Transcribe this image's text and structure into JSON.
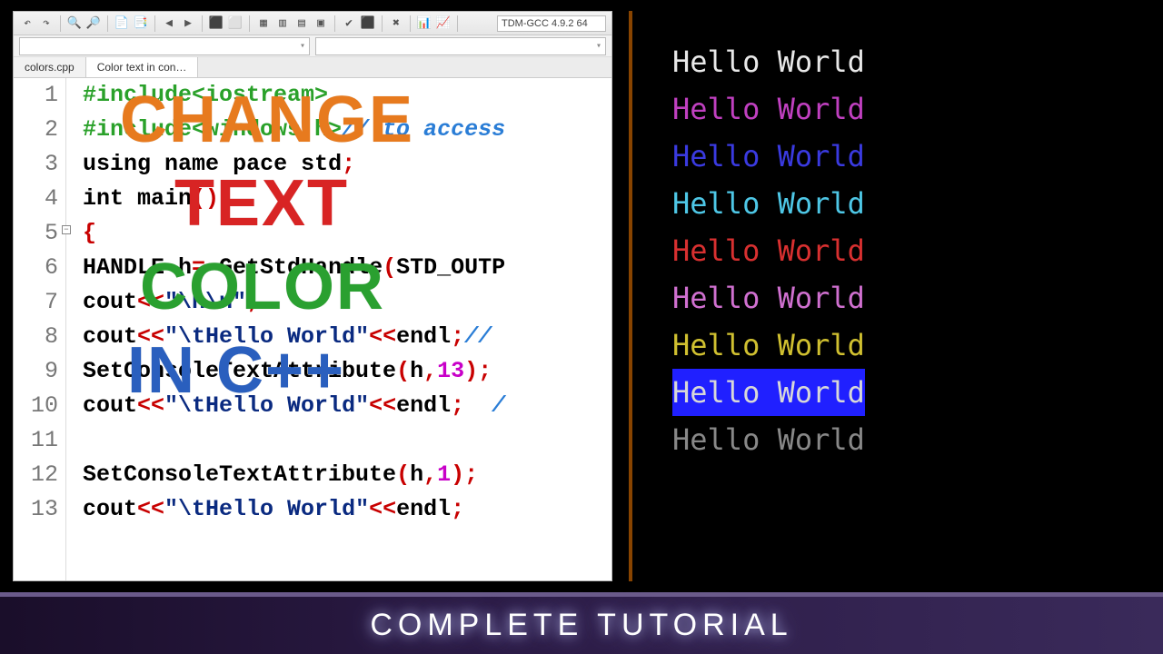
{
  "toolbar": {
    "icons": [
      "↶",
      "↷",
      "|",
      "🔍",
      "🔎",
      "|",
      "📄",
      "📑",
      "|",
      "◀",
      "▶",
      "|",
      "⬛",
      "⬜",
      "|",
      "▦",
      "▥",
      "▤",
      "▣",
      "|",
      "✔",
      "⬛",
      "|",
      "✖",
      "|",
      "📊",
      "📈",
      "|"
    ],
    "compiler": "TDM-GCC 4.9.2 64"
  },
  "tabs": [
    {
      "label": "colors.cpp",
      "active": false
    },
    {
      "label": "Color text in con…",
      "active": true
    }
  ],
  "code": {
    "lines": [
      {
        "n": "1",
        "html": "<span class='pp'>#include&lt;iostream&gt;</span>"
      },
      {
        "n": "2",
        "html": "<span class='pp'>#include&lt;windows.h&gt;</span><span class='cmt'>// to access</span>"
      },
      {
        "n": "3",
        "html": "<span class='kw'>using</span> <span class='kw'>name</span> <span class='kw'>pace</span> <span class='kw'>std</span><span class='sym'>;</span>"
      },
      {
        "n": "4",
        "html": "<span class='kw'>int</span> main<span class='sym'>()</span>"
      },
      {
        "n": "5",
        "html": "<span class='sym'>{</span>",
        "fold": true
      },
      {
        "n": "6",
        "html": "HANDLE h<span class='sym'>=</span> GetStdHandle<span class='sym'>(</span>STD_OUTP"
      },
      {
        "n": "7",
        "html": "cout<span class='sym'>&lt;&lt;</span><span class='str'>\"\\n\\n\"</span><span class='sym'>;</span>"
      },
      {
        "n": "8",
        "html": "cout<span class='sym'>&lt;&lt;</span><span class='str'>\"\\tHello World\"</span><span class='sym'>&lt;&lt;</span>endl<span class='sym'>;</span><span class='cmt'>//</span>"
      },
      {
        "n": "9",
        "html": "SetConsoleTextAttribute<span class='sym'>(</span>h<span class='sym'>,</span><span class='num'>13</span><span class='sym'>);</span>"
      },
      {
        "n": "10",
        "html": "cout<span class='sym'>&lt;&lt;</span><span class='str'>\"\\tHello World\"</span><span class='sym'>&lt;&lt;</span>endl<span class='sym'>;</span>  <span class='cmt'>/</span>"
      },
      {
        "n": "11",
        "html": ""
      },
      {
        "n": "12",
        "html": "SetConsoleTextAttribute<span class='sym'>(</span>h<span class='sym'>,</span><span class='num'>1</span><span class='sym'>);</span>"
      },
      {
        "n": "13",
        "html": "cout<span class='sym'>&lt;&lt;</span><span class='str'>\"\\tHello World\"</span><span class='sym'>&lt;&lt;</span>endl<span class='sym'>;</span>"
      }
    ]
  },
  "console": {
    "rows": [
      {
        "text": "Hello World",
        "cls": "c-white"
      },
      {
        "text": "Hello World",
        "cls": "c-mag"
      },
      {
        "text": "Hello World",
        "cls": "c-blue"
      },
      {
        "text": "Hello World",
        "cls": "c-cyan"
      },
      {
        "text": "Hello World",
        "cls": "c-red"
      },
      {
        "text": "Hello World",
        "cls": "c-lmag"
      },
      {
        "text": "Hello World",
        "cls": "c-yel"
      },
      {
        "text": "Hello World",
        "cls": "c-bgblue"
      },
      {
        "text": "Hello World",
        "cls": "c-gray"
      }
    ]
  },
  "overlay": {
    "line1": "CHANGE",
    "line2": "TEXT",
    "line3": "COLOR",
    "line4": "IN C++"
  },
  "footer": "COMPLETE TUTORIAL"
}
